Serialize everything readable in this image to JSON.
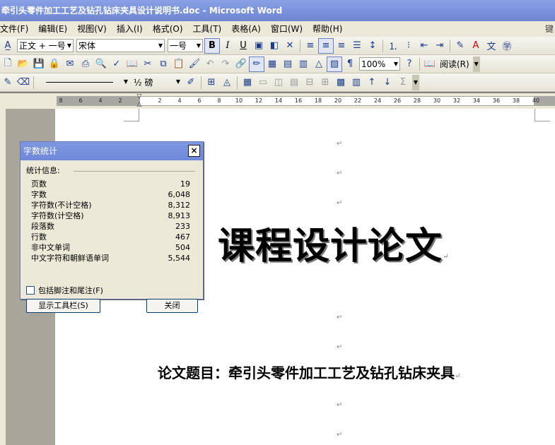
{
  "window": {
    "title": "牵引头零件加工工艺及钻孔钻床夹具设计说明书.doc - Microsoft Word"
  },
  "menu": {
    "items": [
      "文件(F)",
      "编辑(E)",
      "视图(V)",
      "插入(I)",
      "格式(O)",
      "工具(T)",
      "表格(A)",
      "窗口(W)",
      "帮助(H)"
    ],
    "ask_hint": "键"
  },
  "formatting_toolbar": {
    "style": "正文 + 一号",
    "font": "宋体",
    "size": "一号",
    "bold": "B",
    "italic": "I",
    "underline": "U"
  },
  "standard_toolbar": {
    "zoom": "100%",
    "read_label": "阅读(R)"
  },
  "drawing_toolbar": {
    "line_weight": "½ 磅"
  },
  "ruler": {
    "ticks": [
      "8",
      "6",
      "4",
      "2",
      "2",
      "4",
      "6",
      "8",
      "10",
      "12",
      "14",
      "16",
      "18",
      "20",
      "22",
      "24",
      "26",
      "28",
      "30",
      "32",
      "34",
      "36",
      "38",
      "40"
    ]
  },
  "document": {
    "title": "课程设计论文",
    "subtitle": "论文题目：牵引头零件加工工艺及钻孔钻床夹具",
    "para_mark": "↵"
  },
  "word_count_dialog": {
    "title": "字数统计",
    "close_icon": "×",
    "group_label": "统计信息:",
    "stats": [
      {
        "label": "页数",
        "value": "19"
      },
      {
        "label": "字数",
        "value": "6,048"
      },
      {
        "label": "字符数(不计空格)",
        "value": "8,312"
      },
      {
        "label": "字符数(计空格)",
        "value": "8,913"
      },
      {
        "label": "段落数",
        "value": "233"
      },
      {
        "label": "行数",
        "value": "467"
      },
      {
        "label": "非中文单词",
        "value": "504"
      },
      {
        "label": "中文字符和朝鲜语单词",
        "value": "5,544"
      }
    ],
    "include_footnotes_label": "包括脚注和尾注(F)",
    "include_footnotes_checked": false,
    "show_toolbar_button": "显示工具栏(S)",
    "close_button": "关闭"
  },
  "colors": {
    "title_bar": "#7b93dc",
    "chrome": "#ece9d8"
  }
}
